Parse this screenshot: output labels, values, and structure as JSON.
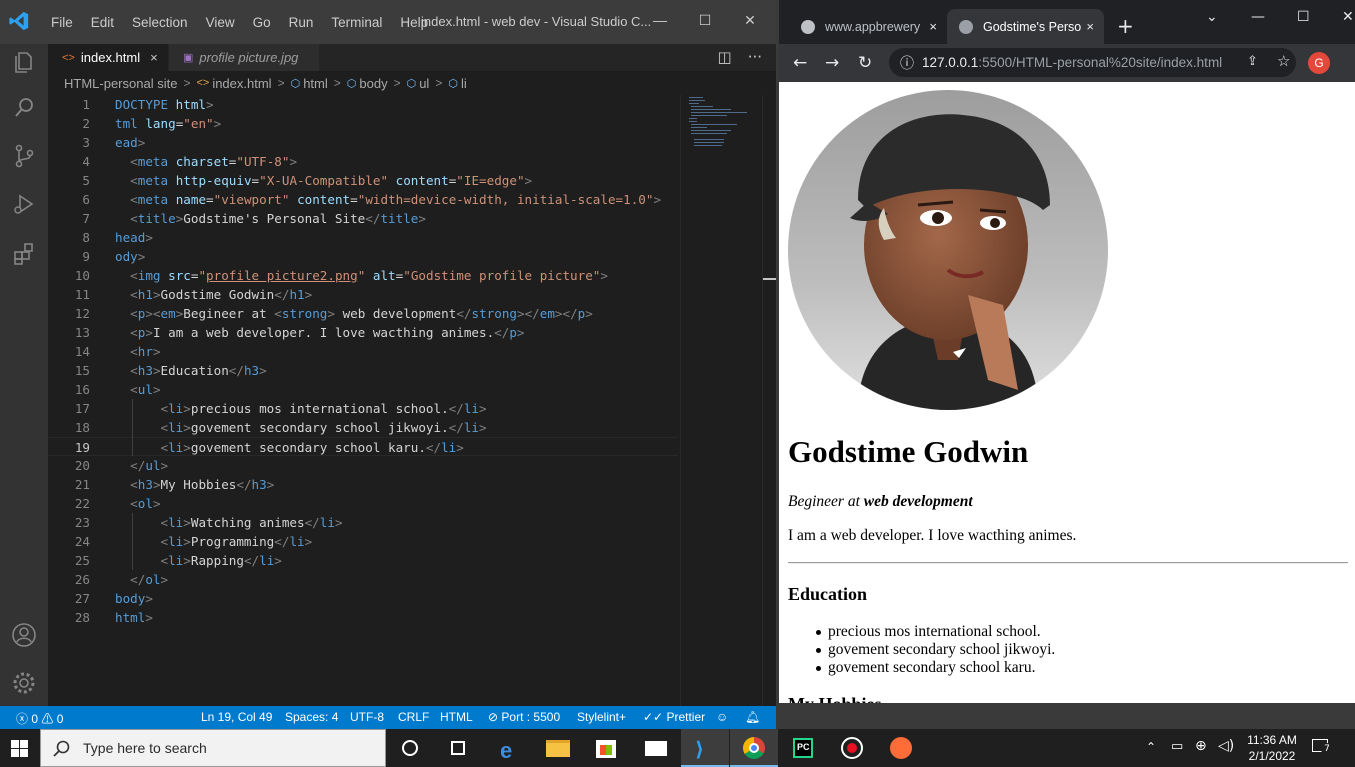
{
  "vscode": {
    "menu": [
      "File",
      "Edit",
      "Selection",
      "View",
      "Go",
      "Run",
      "Terminal",
      "Help"
    ],
    "window_title": "index.html - web dev - Visual Studio C...",
    "tabs": [
      {
        "label": "index.html",
        "close": "×"
      },
      {
        "label": "profile picture.jpg"
      }
    ],
    "breadcrumb": [
      "HTML-personal site",
      "index.html",
      "html",
      "body",
      "ul",
      "li"
    ],
    "active_line": 19,
    "status": {
      "problems": "0",
      "warnings": "0",
      "cursor": "Ln 19, Col 49",
      "spaces": "Spaces: 4",
      "encoding": "UTF-8",
      "eol": "CRLF",
      "language": "HTML",
      "port": "Port : 5500",
      "stylelint": "Stylelint+",
      "prettier": "Prettier"
    }
  },
  "chrome": {
    "tabs": [
      {
        "title": "www.appbrewery",
        "close": "×"
      },
      {
        "title": "Godstime's Perso",
        "close": "×"
      }
    ],
    "url_host": "127.0.0.1",
    "url_rest": ":5500/HTML-personal%20site/index.html",
    "profile_initial": "G",
    "page": {
      "h1": "Godstime Godwin",
      "tag_em": "Begineer at",
      "tag_strong": "web development",
      "about": "I am a web developer. I love wacthing animes.",
      "h3": "Education",
      "education": [
        "precious mos international school.",
        "govement secondary school jikwoyi.",
        "govement secondary school karu."
      ],
      "cut_heading": "My Hobbies"
    }
  },
  "taskbar": {
    "search_placeholder": "Type here to search",
    "time": "11:36 AM",
    "date": "2/1/2022",
    "notifications": "7"
  },
  "colors": {
    "vscode_blue": "#007acc",
    "tag": "#569cd6",
    "attr": "#9cdcfe",
    "string": "#ce9178"
  }
}
